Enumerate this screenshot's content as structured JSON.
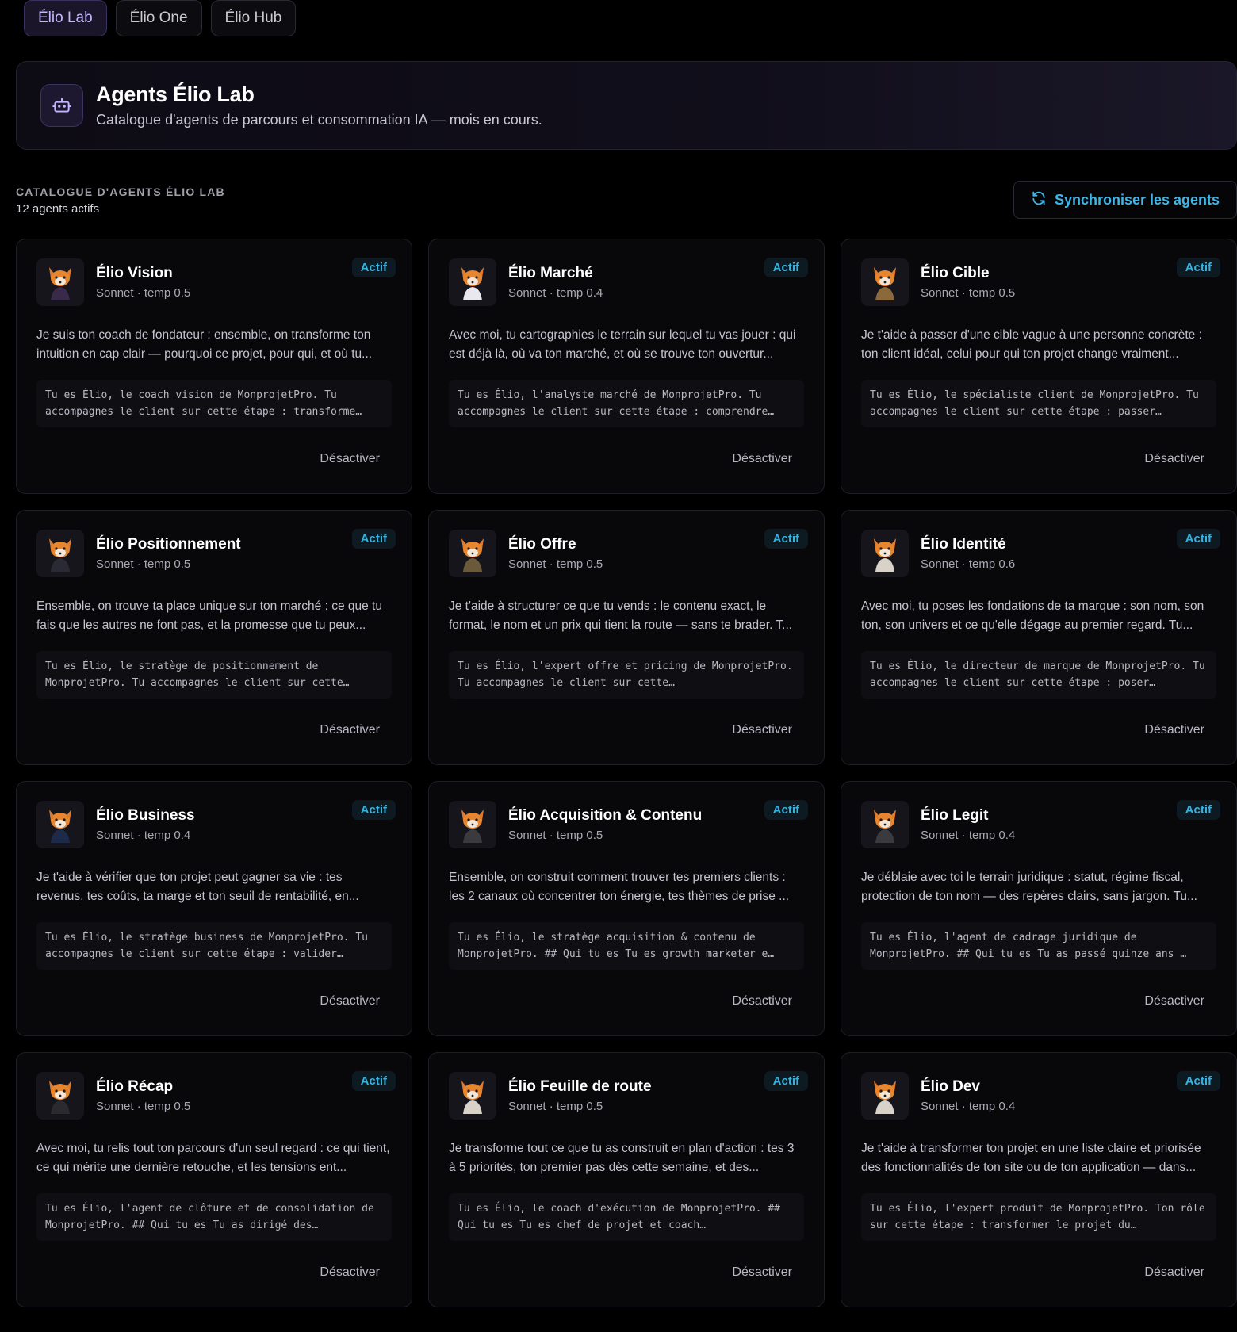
{
  "tabs": [
    {
      "label": "Élio Lab",
      "active": true
    },
    {
      "label": "Élio One",
      "active": false
    },
    {
      "label": "Élio Hub",
      "active": false
    }
  ],
  "banner": {
    "title": "Agents Élio Lab",
    "subtitle": "Catalogue d'agents de parcours et consommation IA — mois en cours.",
    "icon": "robot-icon"
  },
  "section": {
    "label": "CATALOGUE D'AGENTS ÉLIO LAB",
    "count": "12 agents actifs",
    "sync_label": "Synchroniser les agents",
    "sync_icon": "refresh-icon"
  },
  "colors": {
    "accent": "#3fb6e6",
    "active_tab": "#c4b5ff",
    "card_bg": "#08080b"
  },
  "agents": [
    {
      "name": "Élio Vision",
      "meta": "Sonnet · temp 0.5",
      "badge": "Actif",
      "desc": "Je suis ton coach de fondateur : ensemble, on transforme ton intuition en cap clair — pourquoi ce projet, pour qui, et où tu...",
      "prompt": "Tu es Élio, le coach vision de MonprojetPro. Tu accompagnes le client sur cette étape : transforme…",
      "action": "Désactiver"
    },
    {
      "name": "Élio Marché",
      "meta": "Sonnet · temp 0.4",
      "badge": "Actif",
      "desc": "Avec moi, tu cartographies le terrain sur lequel tu vas jouer : qui est déjà là, où va ton marché, et où se trouve ton ouvertur...",
      "prompt": "Tu es Élio, l'analyste marché de MonprojetPro. Tu accompagnes le client sur cette étape : comprendre…",
      "action": "Désactiver"
    },
    {
      "name": "Élio Cible",
      "meta": "Sonnet · temp 0.5",
      "badge": "Actif",
      "desc": "Je t'aide à passer d'une cible vague à une personne concrète : ton client idéal, celui pour qui ton projet change vraiment...",
      "prompt": "Tu es Élio, le spécialiste client de MonprojetPro. Tu accompagnes le client sur cette étape : passer…",
      "action": "Désactiver"
    },
    {
      "name": "Élio Positionnement",
      "meta": "Sonnet · temp 0.5",
      "badge": "Actif",
      "desc": "Ensemble, on trouve ta place unique sur ton marché : ce que tu fais que les autres ne font pas, et la promesse que tu peux...",
      "prompt": "Tu es Élio, le stratège de positionnement de MonprojetPro. Tu accompagnes le client sur cette…",
      "action": "Désactiver"
    },
    {
      "name": "Élio Offre",
      "meta": "Sonnet · temp 0.5",
      "badge": "Actif",
      "desc": "Je t'aide à structurer ce que tu vends : le contenu exact, le format, le nom et un prix qui tient la route — sans te brader. T...",
      "prompt": "Tu es Élio, l'expert offre et pricing de MonprojetPro. Tu accompagnes le client sur cette…",
      "action": "Désactiver"
    },
    {
      "name": "Élio Identité",
      "meta": "Sonnet · temp 0.6",
      "badge": "Actif",
      "desc": "Avec moi, tu poses les fondations de ta marque : son nom, son ton, son univers et ce qu'elle dégage au premier regard. Tu...",
      "prompt": "Tu es Élio, le directeur de marque de MonprojetPro. Tu accompagnes le client sur cette étape : poser…",
      "action": "Désactiver"
    },
    {
      "name": "Élio Business",
      "meta": "Sonnet · temp 0.4",
      "badge": "Actif",
      "desc": "Je t'aide à vérifier que ton projet peut gagner sa vie : tes revenus, tes coûts, ta marge et ton seuil de rentabilité, en...",
      "prompt": "Tu es Élio, le stratège business de MonprojetPro. Tu accompagnes le client sur cette étape : valider…",
      "action": "Désactiver"
    },
    {
      "name": "Élio Acquisition & Contenu",
      "meta": "Sonnet · temp 0.5",
      "badge": "Actif",
      "desc": "Ensemble, on construit comment trouver tes premiers clients : les 2 canaux où concentrer ton énergie, tes thèmes de prise ...",
      "prompt": "Tu es Élio, le stratège acquisition & contenu de MonprojetPro. ## Qui tu es Tu es growth marketer e…",
      "action": "Désactiver"
    },
    {
      "name": "Élio Legit",
      "meta": "Sonnet · temp 0.4",
      "badge": "Actif",
      "desc": "Je déblaie avec toi le terrain juridique : statut, régime fiscal, protection de ton nom — des repères clairs, sans jargon. Tu...",
      "prompt": "Tu es Élio, l'agent de cadrage juridique de MonprojetPro. ## Qui tu es Tu as passé quinze ans …",
      "action": "Désactiver"
    },
    {
      "name": "Élio Récap",
      "meta": "Sonnet · temp 0.5",
      "badge": "Actif",
      "desc": "Avec moi, tu relis tout ton parcours d'un seul regard : ce qui tient, ce qui mérite une dernière retouche, et les tensions ent...",
      "prompt": "Tu es Élio, l'agent de clôture et de consolidation de MonprojetPro. ## Qui tu es Tu as dirigé des…",
      "action": "Désactiver"
    },
    {
      "name": "Élio Feuille de route",
      "meta": "Sonnet · temp 0.5",
      "badge": "Actif",
      "desc": "Je transforme tout ce que tu as construit en plan d'action : tes 3 à 5 priorités, ton premier pas dès cette semaine, et des...",
      "prompt": "Tu es Élio, le coach d'exécution de MonprojetPro. ## Qui tu es Tu es chef de projet et coach…",
      "action": "Désactiver"
    },
    {
      "name": "Élio Dev",
      "meta": "Sonnet · temp 0.4",
      "badge": "Actif",
      "desc": "Je t'aide à transformer ton projet en une liste claire et priorisée des fonctionnalités de ton site ou de ton application — dans...",
      "prompt": "Tu es Élio, l'expert produit de MonprojetPro. Ton rôle sur cette étape : transformer le projet du…",
      "action": "Désactiver"
    }
  ]
}
